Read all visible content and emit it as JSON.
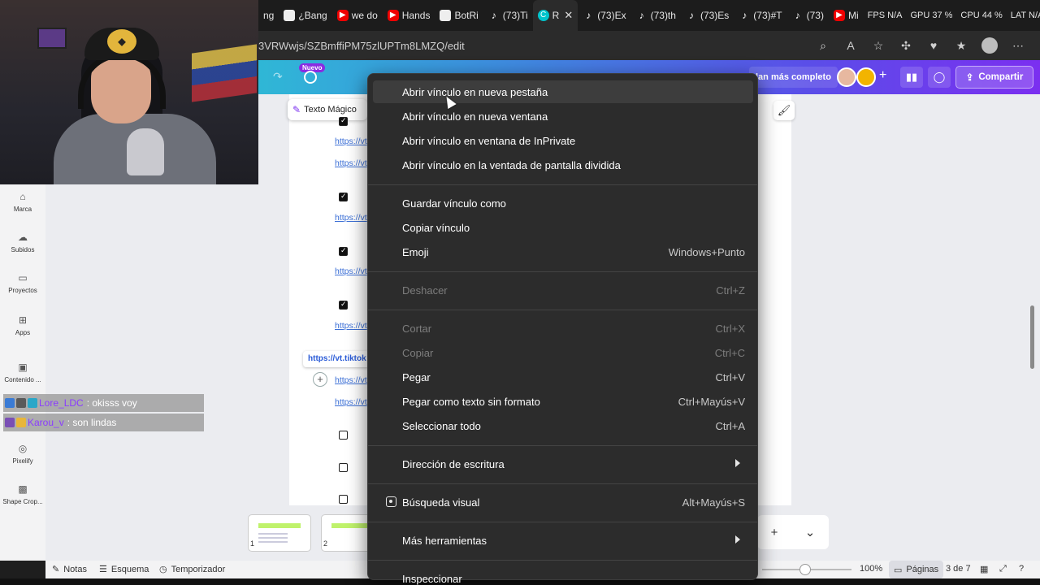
{
  "browser": {
    "tabs": [
      {
        "label": "ng",
        "icon": "gen"
      },
      {
        "label": "¿Bang",
        "icon": "gen"
      },
      {
        "label": "we do",
        "icon": "yt"
      },
      {
        "label": "Hands",
        "icon": "yt"
      },
      {
        "label": "BotRi",
        "icon": "gen"
      },
      {
        "label": "(73)Ti",
        "icon": "tt"
      },
      {
        "label": "R",
        "icon": "canva",
        "active": true
      },
      {
        "label": "(73)Ex",
        "icon": "tt"
      },
      {
        "label": "(73)th",
        "icon": "tt"
      },
      {
        "label": "(73)Es",
        "icon": "tt"
      },
      {
        "label": "(73)#T",
        "icon": "tt"
      },
      {
        "label": "(73)",
        "icon": "tt"
      },
      {
        "label": "Mi",
        "icon": "yt"
      }
    ],
    "stats": [
      "FPS N/A",
      "GPU 37 %",
      "CPU 44 %",
      "LAT N/A"
    ],
    "url": "3VRWwjs/SZBmffiPM75zlUPTm8LMZQ/edit"
  },
  "canva": {
    "nuevo_badge": "Nuevo",
    "plan_label": "lan más completo",
    "share_label": "Compartir",
    "text_magic_label": "Texto Mágico",
    "sidebar": [
      {
        "label": "Marca",
        "icon": "brand-icon"
      },
      {
        "label": "Subidos",
        "icon": "upload-cloud-icon"
      },
      {
        "label": "Proyectos",
        "icon": "folder-icon"
      },
      {
        "label": "Apps",
        "icon": "apps-grid-icon"
      },
      {
        "label": "Contenido ...",
        "icon": "content-icon"
      },
      {
        "label": "Pixelify",
        "icon": "pixelify-app-icon"
      },
      {
        "label": "Shape Crop...",
        "icon": "shape-crop-app-icon"
      }
    ],
    "doc_links": [
      "https://vt",
      "https://vt",
      "https://vt",
      "https://vt",
      "https://vt",
      "https://vt",
      "https://vt"
    ],
    "link_pill": "https://vt.tiktok",
    "thumb_numbers": [
      "1",
      "2"
    ],
    "bottom": {
      "notes": "Notas",
      "outline": "Esquema",
      "timer": "Temporizador",
      "zoom": "100%",
      "pages": "Páginas",
      "page_count": "3 de 7"
    }
  },
  "chat": [
    {
      "user": "Lore_LDC",
      "message": ": okisss voy",
      "user_color": "#8a3cff"
    },
    {
      "user": "Karou_v",
      "message": ": son lindas",
      "user_color": "#8a3cff"
    }
  ],
  "context_menu": {
    "groups": [
      [
        {
          "label": "Abrir vínculo en nueva pestaña",
          "shortcut": "",
          "hover": true
        },
        {
          "label": "Abrir vínculo en nueva ventana",
          "shortcut": ""
        },
        {
          "label": "Abrir vínculo en ventana de InPrivate",
          "shortcut": ""
        },
        {
          "label": "Abrir vínculo en la ventada de pantalla dividida",
          "shortcut": ""
        }
      ],
      [
        {
          "label": "Guardar vínculo como",
          "shortcut": ""
        },
        {
          "label": "Copiar vínculo",
          "shortcut": ""
        },
        {
          "label": "Emoji",
          "shortcut": "Windows+Punto"
        }
      ],
      [
        {
          "label": "Deshacer",
          "shortcut": "Ctrl+Z",
          "disabled": true
        }
      ],
      [
        {
          "label": "Cortar",
          "shortcut": "Ctrl+X",
          "disabled": true
        },
        {
          "label": "Copiar",
          "shortcut": "Ctrl+C",
          "disabled": true
        },
        {
          "label": "Pegar",
          "shortcut": "Ctrl+V"
        },
        {
          "label": "Pegar como texto sin formato",
          "shortcut": "Ctrl+Mayús+V"
        },
        {
          "label": "Seleccionar todo",
          "shortcut": "Ctrl+A"
        }
      ],
      [
        {
          "label": "Dirección de escritura",
          "shortcut": "",
          "submenu": true
        }
      ],
      [
        {
          "label": "Búsqueda visual",
          "shortcut": "Alt+Mayús+S",
          "icon": true
        }
      ],
      [
        {
          "label": "Más herramientas",
          "shortcut": "",
          "submenu": true
        }
      ],
      [
        {
          "label": "Inspeccionar",
          "shortcut": ""
        }
      ]
    ]
  }
}
